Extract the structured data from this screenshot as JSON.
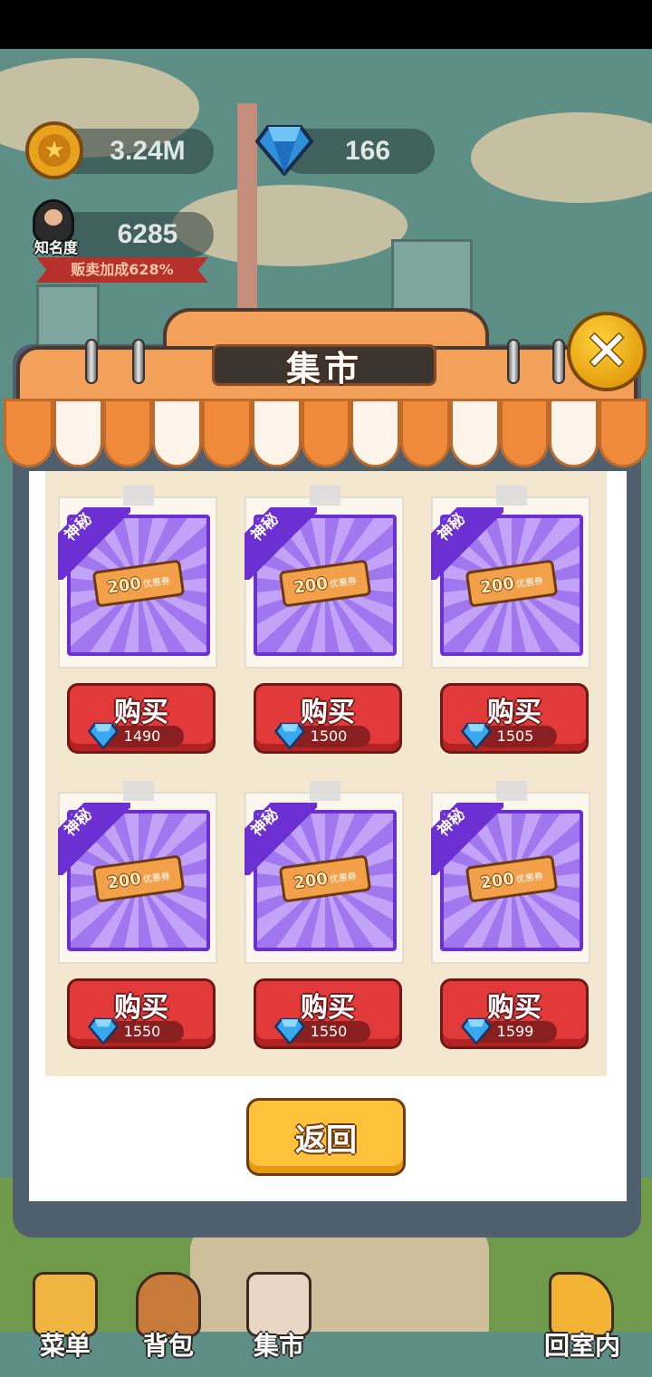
{
  "hud": {
    "coins": "3.24M",
    "gems": "166",
    "fame_label": "知名度",
    "fame_value": "6285",
    "sales_bonus": "贩卖加成628%"
  },
  "dialog": {
    "title": "集市",
    "close_symbol": "✕",
    "items": [
      {
        "badge": "神秘",
        "ticket_value": "200",
        "ticket_text": "优惠券",
        "buy_label": "购买",
        "price": "1490"
      },
      {
        "badge": "神秘",
        "ticket_value": "200",
        "ticket_text": "优惠券",
        "buy_label": "购买",
        "price": "1500"
      },
      {
        "badge": "神秘",
        "ticket_value": "200",
        "ticket_text": "优惠券",
        "buy_label": "购买",
        "price": "1505"
      },
      {
        "badge": "神秘",
        "ticket_value": "200",
        "ticket_text": "优惠券",
        "buy_label": "购买",
        "price": "1550"
      },
      {
        "badge": "神秘",
        "ticket_value": "200",
        "ticket_text": "优惠券",
        "buy_label": "购买",
        "price": "1550"
      },
      {
        "badge": "神秘",
        "ticket_value": "200",
        "ticket_text": "优惠券",
        "buy_label": "购买",
        "price": "1599"
      }
    ],
    "back_label": "返回"
  },
  "nav": [
    {
      "label": "菜单",
      "icon": "menu-book-icon"
    },
    {
      "label": "背包",
      "icon": "backpack-icon"
    },
    {
      "label": "集市",
      "icon": "market-icon"
    },
    {
      "label": "回室内",
      "icon": "return-home-icon"
    }
  ],
  "colors": {
    "awning_orange": "#ef8a3a",
    "item_purple": "#6c2fd1",
    "buy_red": "#e23a3a",
    "back_yellow": "#ffc23a"
  }
}
